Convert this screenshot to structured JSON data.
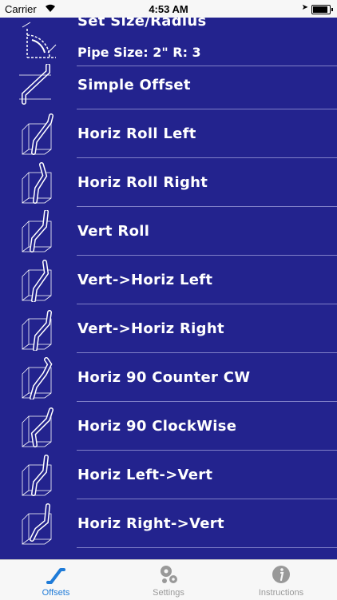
{
  "status": {
    "carrier": "Carrier",
    "time": "4:53 AM"
  },
  "list": {
    "header_title": "Set Size/Radius",
    "header_subtitle": "Pipe Size: 2\"  R: 3",
    "items": [
      {
        "label": "Simple Offset"
      },
      {
        "label": "Horiz Roll Left"
      },
      {
        "label": "Horiz Roll Right"
      },
      {
        "label": "Vert Roll"
      },
      {
        "label": "Vert->Horiz Left"
      },
      {
        "label": "Vert->Horiz Right"
      },
      {
        "label": "Horiz 90 Counter CW"
      },
      {
        "label": "Horiz 90 ClockWise"
      },
      {
        "label": "Horiz Left->Vert"
      },
      {
        "label": "Horiz Right->Vert"
      }
    ]
  },
  "tabs": [
    {
      "label": "Offsets",
      "icon": "offsets-pipe-icon",
      "active": true
    },
    {
      "label": "Settings",
      "icon": "gears-icon",
      "active": false
    },
    {
      "label": "Instructions",
      "icon": "info-icon",
      "active": false
    }
  ],
  "colors": {
    "background": "#23238e",
    "active_tab": "#1e7bd8",
    "inactive_tab": "#999999"
  }
}
